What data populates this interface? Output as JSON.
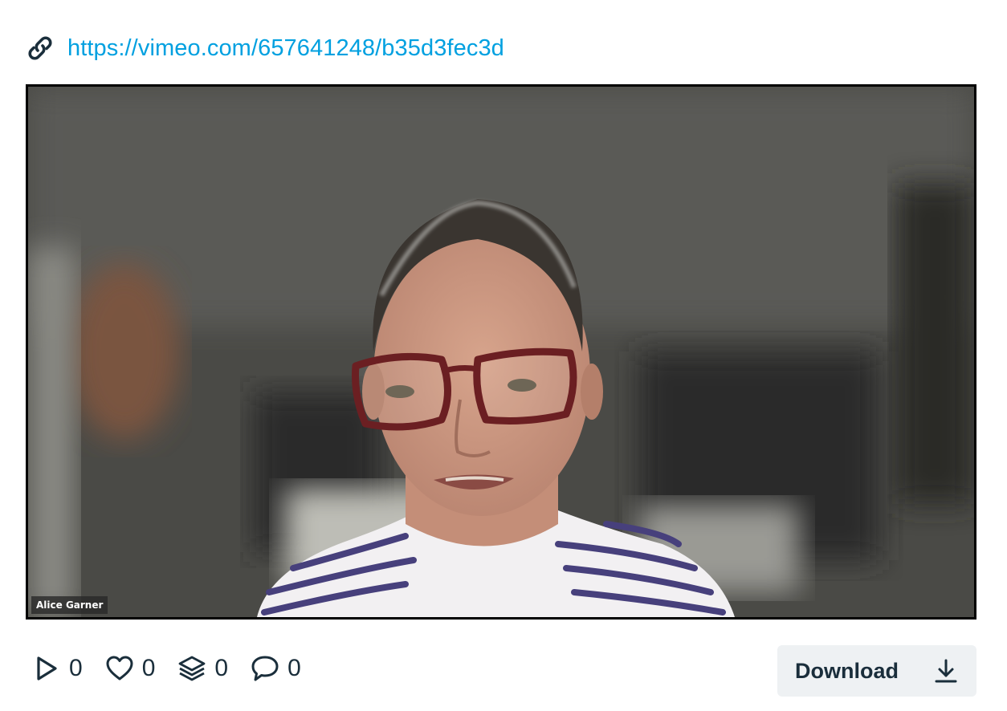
{
  "link": {
    "url": "https://vimeo.com/657641248/b35d3fec3d",
    "icon": "link-icon"
  },
  "video": {
    "participant_name": "Alice Garner"
  },
  "stats": {
    "plays": "0",
    "likes": "0",
    "collections": "0",
    "comments": "0"
  },
  "actions": {
    "download_label": "Download"
  },
  "colors": {
    "link": "#00a0e0",
    "text_dark": "#1a2e3b",
    "button_bg": "#eef1f3"
  }
}
